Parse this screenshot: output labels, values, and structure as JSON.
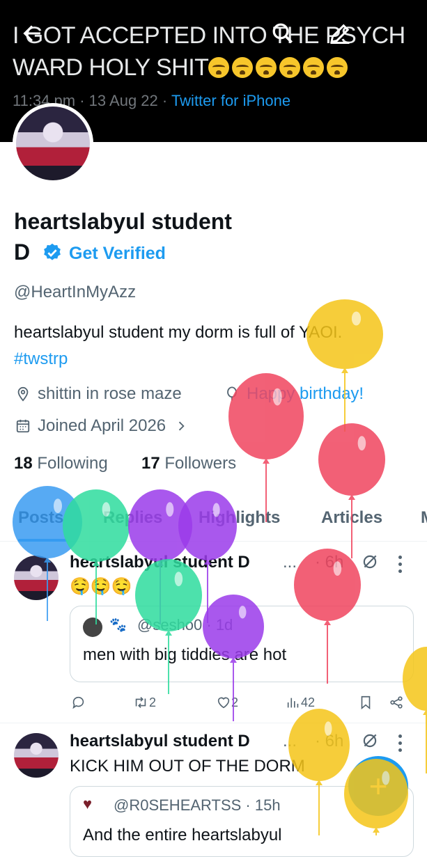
{
  "banner": {
    "tweet_text": "I GOT ACCEPTED INTO THE PSYCH WARD HOLY SHIT",
    "emoji_count": 6,
    "emoji": "loudly-crying-face",
    "time": "11:34 pm",
    "sep1": " · ",
    "date": "13 Aug 22",
    "sep2": " · ",
    "source": "Twitter for iPhone"
  },
  "header": {
    "back_icon": "arrow-left-icon",
    "search_icon": "search-icon",
    "edit_icon": "pencil-icon"
  },
  "profile": {
    "name_line1": "heartslabyul student",
    "name_line2": "D",
    "get_verified": "Get Verified",
    "handle": "@HeartInMyAzz",
    "bio": "heartslabyul student my dorm is full of YAOI. ",
    "bio_hashtag": "#twstrp",
    "location": "shittin in rose maze",
    "birthday": "Happy birthday!",
    "joined": "Joined April 2026",
    "following_count": "18",
    "following_label": " Following",
    "followers_count": "17",
    "followers_label": " Followers"
  },
  "tabs": [
    "Posts",
    "Replies",
    "Highlights",
    "Articles",
    "M"
  ],
  "posts": [
    {
      "author": "heartslabyul student D",
      "ellipsis": "...",
      "time": "· 6h",
      "text": "🤤🤤🤤",
      "quote_handle": "@sesho0 · 1d",
      "quote_text": "men with big tiddies are hot",
      "retweets": "2",
      "likes": "2",
      "views": "42"
    },
    {
      "author": "heartslabyul student D",
      "ellipsis": "...",
      "time": "· 6h",
      "text": "KICK HIM OUT OF THE DORM",
      "quote_handle": "@R0SEHEARTSS · 15h",
      "quote_text": "And the entire heartslabyul"
    }
  ],
  "fab": {
    "label": "+"
  },
  "colors": {
    "accent": "#1d9bf0",
    "banner_bg": "#000000",
    "balloon_yellow": "#f5c518",
    "balloon_pink": "#f0455f",
    "balloon_purple": "#9b3bea",
    "balloon_green": "#2fdc9e",
    "balloon_blue": "#3a9cf2"
  }
}
